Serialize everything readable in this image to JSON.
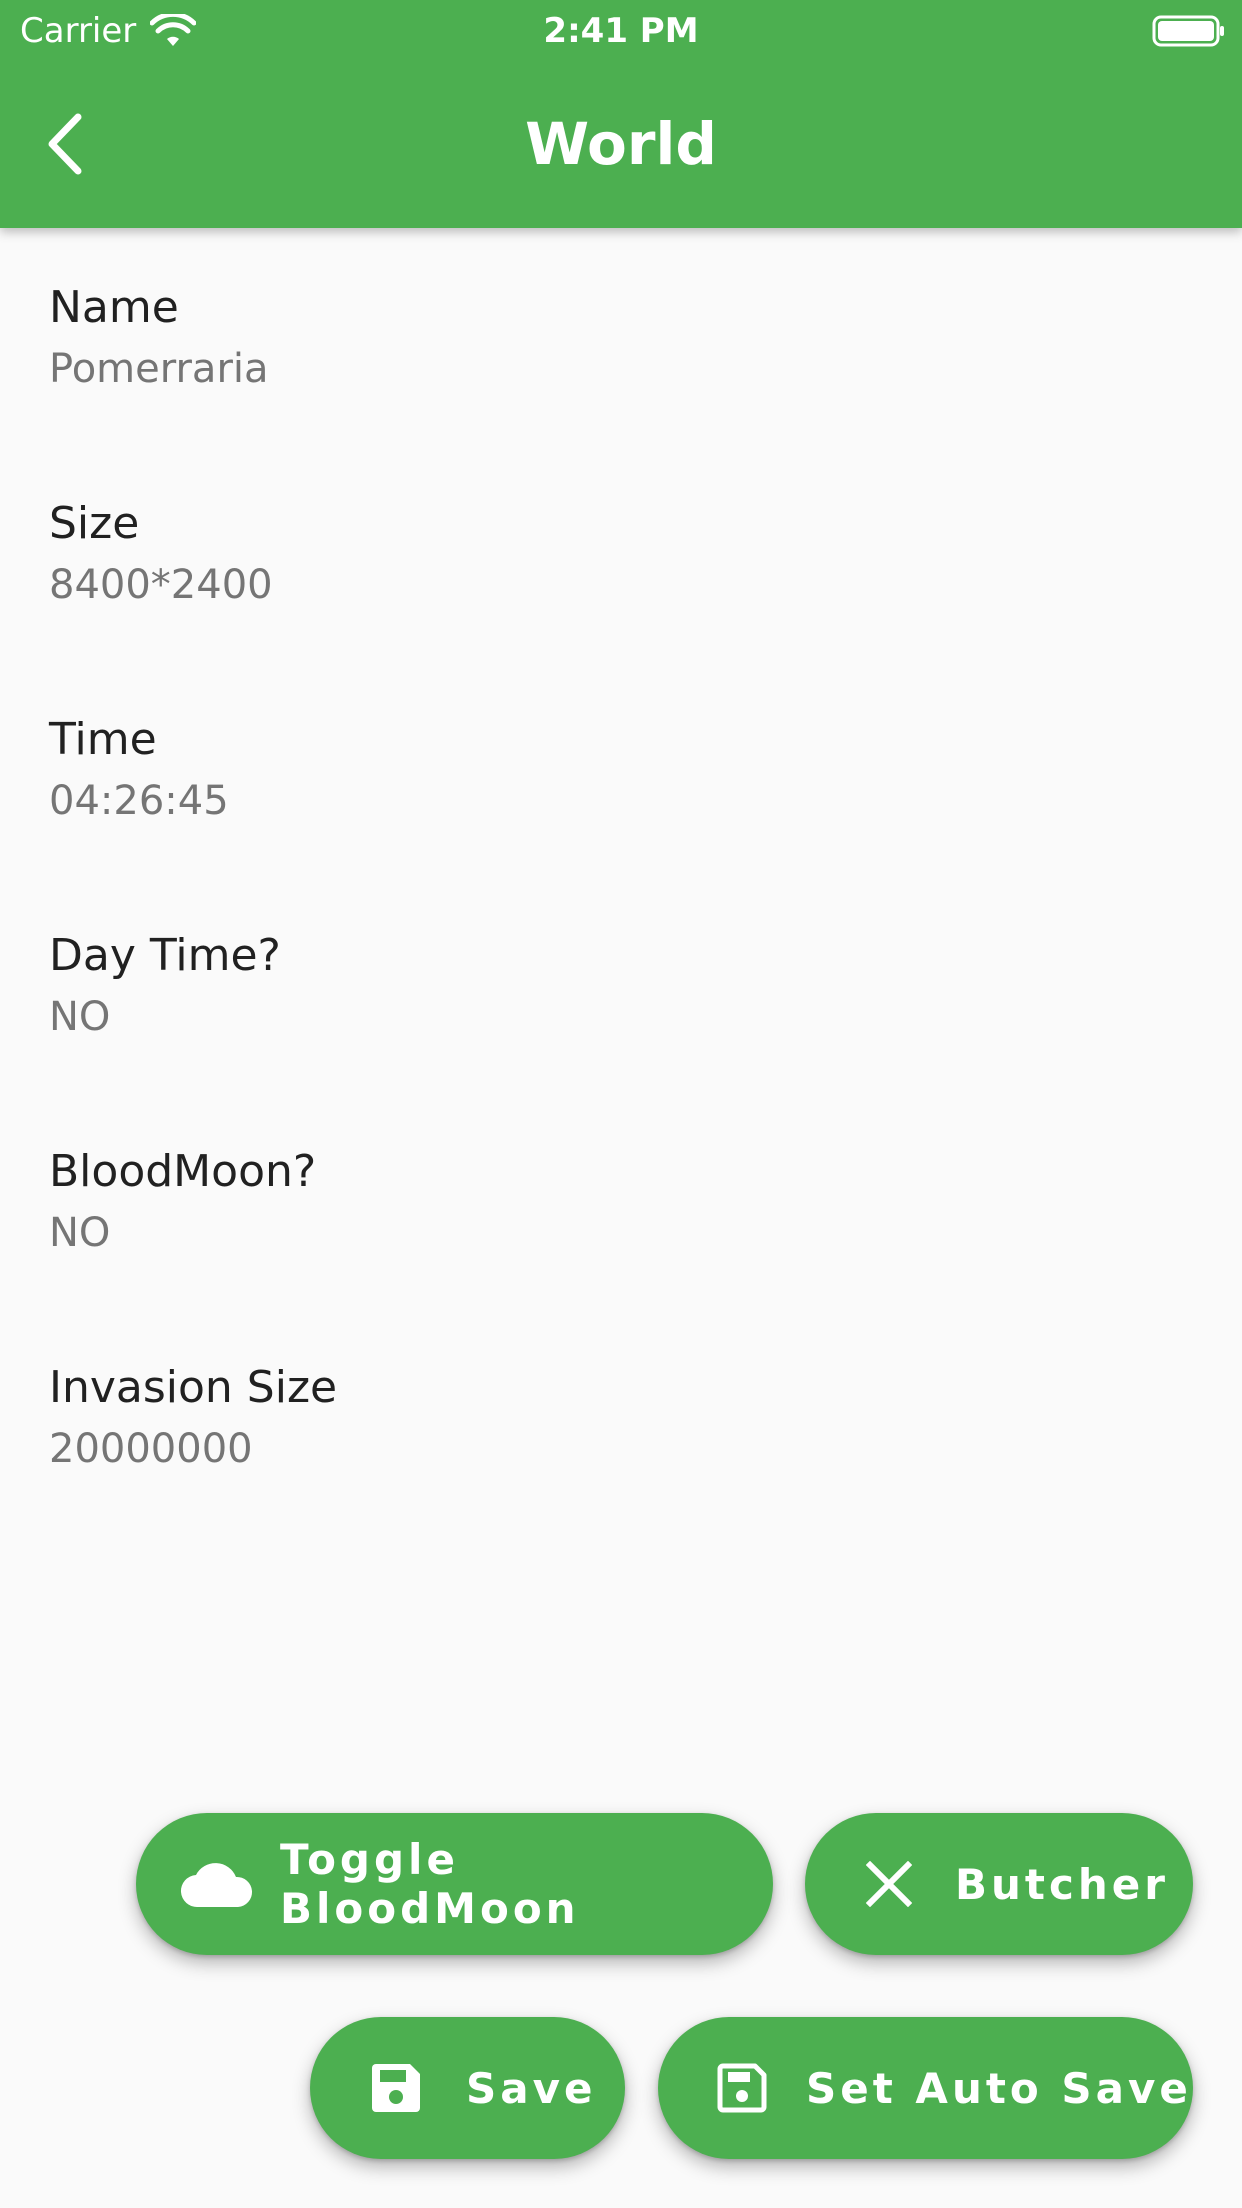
{
  "status_bar": {
    "carrier": "Carrier",
    "time": "2:41 PM",
    "wifi_icon": "wifi-icon",
    "battery_icon": "battery-full-icon"
  },
  "app_bar": {
    "title": "World",
    "back_icon": "chevron-left-icon",
    "color": "#4caf50"
  },
  "world": {
    "fields": [
      {
        "label": "Name",
        "value": "Pomerraria"
      },
      {
        "label": "Size",
        "value": "8400*2400"
      },
      {
        "label": "Time",
        "value": "04:26:45"
      },
      {
        "label": "Day Time?",
        "value": "NO"
      },
      {
        "label": "BloodMoon?",
        "value": "NO"
      },
      {
        "label": "Invasion Size",
        "value": "20000000"
      }
    ]
  },
  "actions": {
    "toggle_bloodmoon": {
      "label": "Toggle BloodMoon",
      "icon": "cloud-icon"
    },
    "butcher": {
      "label": "Butcher",
      "icon": "close-icon"
    },
    "save": {
      "label": "Save",
      "icon": "save-icon"
    },
    "set_auto_save": {
      "label": "Set Auto Save",
      "icon": "save-outline-icon"
    }
  },
  "colors": {
    "accent": "#4caf50",
    "background": "#fafafa",
    "label_text": "#212121",
    "value_text": "#757575"
  }
}
